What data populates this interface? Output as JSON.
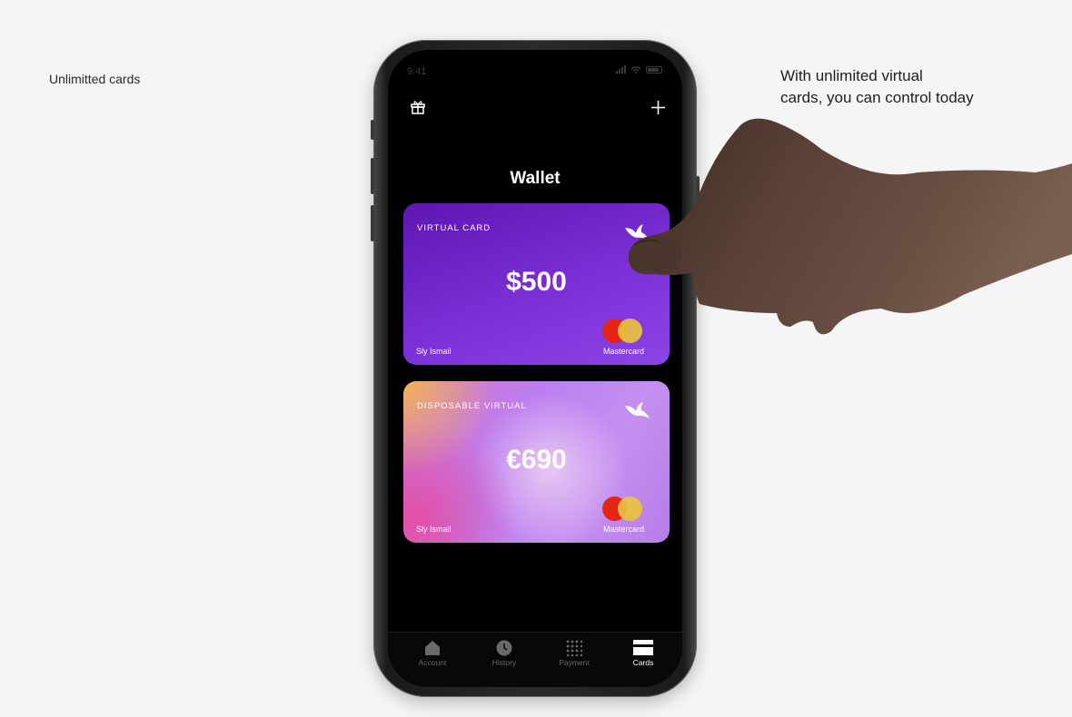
{
  "left_caption": "Unlimitted cards",
  "right_caption": {
    "line1": "With unlimited virtual",
    "line2": "cards, you  can control today"
  },
  "status_bar": {
    "time": "9:41"
  },
  "header": {
    "title": "Wallet",
    "left_icon": "gift-icon",
    "right_icon": "plus-icon"
  },
  "cards": [
    {
      "type": "VIRTUAL CARD",
      "amount": "$500",
      "holder": "Sly Ismail",
      "brand": "Mastercard"
    },
    {
      "type": "DISPOSABLE VIRTUAL",
      "amount": "€690",
      "holder": "Sly Ismail",
      "brand": "Mastercard"
    }
  ],
  "tabbar": {
    "items": [
      {
        "label": "Account",
        "icon": "home-icon",
        "active": false
      },
      {
        "label": "History",
        "icon": "clock-icon",
        "active": false
      },
      {
        "label": "Payment",
        "icon": "grid-icon",
        "active": false
      },
      {
        "label": "Cards",
        "icon": "card-icon",
        "active": true
      }
    ]
  },
  "colors": {
    "background": "#f5f5f5",
    "screen": "#000000",
    "card1": "#7a30d6",
    "card2": "#c58ff1",
    "mastercard_red": "#e32416",
    "mastercard_yellow": "#e9c23d"
  }
}
